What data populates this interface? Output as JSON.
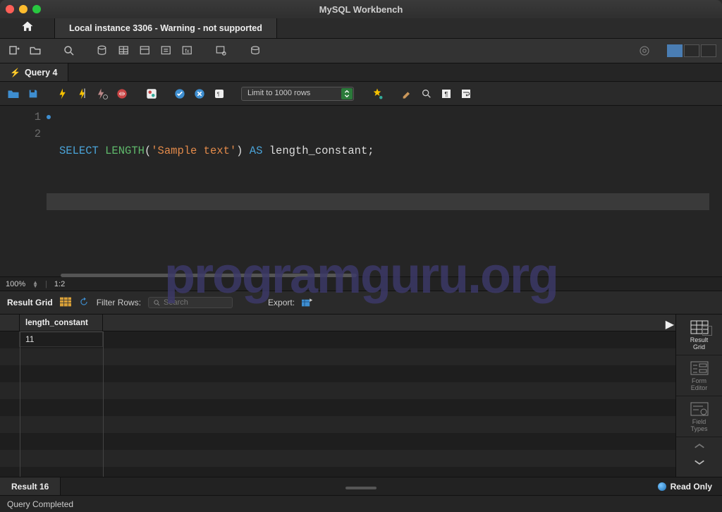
{
  "app_title": "MySQL Workbench",
  "connection_tab": "Local instance 3306 - Warning - not supported",
  "query_tab": "Query 4",
  "limit_selector": "Limit to 1000 rows",
  "editor": {
    "line1": {
      "kw1": "SELECT",
      "fn": "LENGTH",
      "paren_open": "(",
      "str": "'Sample text'",
      "paren_close": ")",
      "kw2": "AS",
      "alias": "length_constant",
      "semi": ";"
    },
    "line_numbers": [
      "1",
      "2"
    ]
  },
  "zoom": {
    "pct": "100%",
    "pos": "1:2"
  },
  "watermark": "programguru.org",
  "result_toolbar": {
    "title": "Result Grid",
    "filter_label": "Filter Rows:",
    "search_placeholder": "Search",
    "export_label": "Export:"
  },
  "result": {
    "columns": [
      "length_constant"
    ],
    "rows": [
      [
        "11"
      ]
    ]
  },
  "side_panels": {
    "result_grid": "Result\nGrid",
    "form_editor": "Form\nEditor",
    "field_types": "Field\nTypes"
  },
  "result_tab": "Result 16",
  "read_only": "Read Only",
  "status": "Query Completed"
}
